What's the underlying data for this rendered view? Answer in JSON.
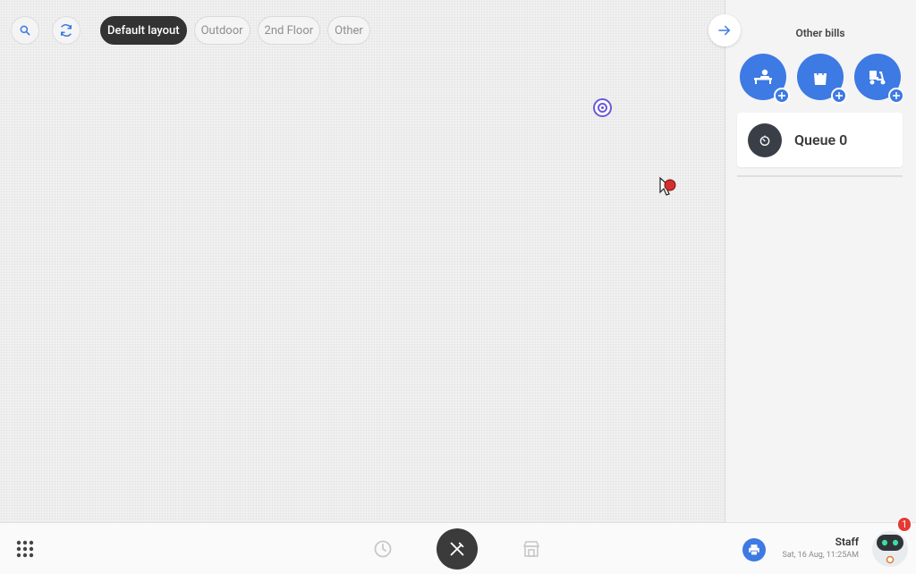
{
  "topbar": {
    "search_icon": "search-icon",
    "refresh_icon": "refresh-icon",
    "layouts": [
      {
        "label": "Default layout",
        "active": true
      },
      {
        "label": "Outdoor",
        "active": false
      },
      {
        "label": "2nd Floor",
        "active": false
      },
      {
        "label": "Other",
        "active": false
      }
    ]
  },
  "right_panel": {
    "title": "Other bills",
    "bill_types": [
      {
        "icon": "dine-in-icon"
      },
      {
        "icon": "takeaway-bag-icon"
      },
      {
        "icon": "delivery-scooter-icon"
      }
    ],
    "queue_label": "Queue 0"
  },
  "bottombar": {
    "staff_name": "Staff",
    "datetime": "Sat, 16 Aug, 11:25AM",
    "notification_count": "1"
  },
  "colors": {
    "accent": "#3d7ae3",
    "dark": "#3b3b3b",
    "badge": "#e53935"
  }
}
